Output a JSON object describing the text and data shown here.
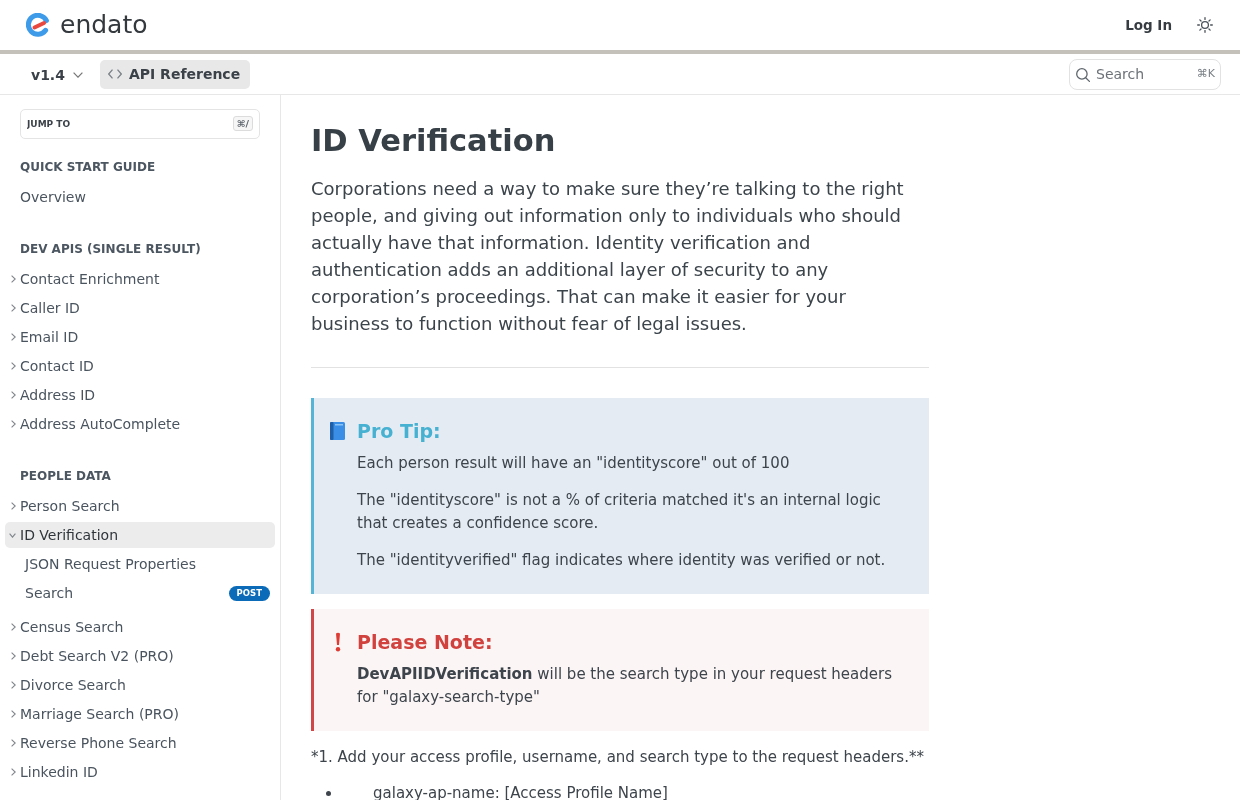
{
  "header": {
    "brand": "endato",
    "login": "Log In"
  },
  "subheader": {
    "version": "v1.4",
    "tabs": [
      {
        "label": "API Reference",
        "selected": true
      }
    ],
    "search": {
      "placeholder": "Search",
      "shortcut": "⌘K"
    }
  },
  "sidebar": {
    "jump_to": {
      "placeholder": "JUMP TO",
      "shortcut": "⌘/"
    },
    "sections": [
      {
        "heading": "QUICK START GUIDE",
        "items": [
          {
            "label": "Overview",
            "selected": false
          }
        ]
      },
      {
        "heading": "DEV APIS (SINGLE RESULT)",
        "items": [
          {
            "label": "Contact Enrichment",
            "selected": false,
            "expanded": false
          },
          {
            "label": "Caller ID",
            "selected": false,
            "expanded": false
          },
          {
            "label": "Email ID",
            "selected": false,
            "expanded": false
          },
          {
            "label": "Contact ID",
            "selected": false,
            "expanded": false
          },
          {
            "label": "Address ID",
            "selected": false,
            "expanded": false
          },
          {
            "label": "Address AutoComplete",
            "selected": false,
            "expanded": false
          }
        ]
      },
      {
        "heading": "PEOPLE DATA",
        "items": [
          {
            "label": "Person Search",
            "selected": false,
            "expanded": false
          },
          {
            "label": "ID Verification",
            "selected": true,
            "expanded": true,
            "children": [
              {
                "label": "JSON Request Properties",
                "selected": false
              },
              {
                "label": "Search",
                "selected": false,
                "badge": "POST"
              }
            ]
          },
          {
            "label": "Census Search",
            "selected": false,
            "expanded": false
          },
          {
            "label": "Debt Search V2 (PRO)",
            "selected": false,
            "expanded": false
          },
          {
            "label": "Divorce Search",
            "selected": false,
            "expanded": false
          },
          {
            "label": "Marriage Search (PRO)",
            "selected": false,
            "expanded": false
          },
          {
            "label": "Reverse Phone Search",
            "selected": false,
            "expanded": false
          },
          {
            "label": "Linkedin ID",
            "selected": false,
            "expanded": false
          }
        ]
      }
    ]
  },
  "main": {
    "title": "ID Verification",
    "intro": "Corporations need a way to make sure they’re talking to the right people, and giving out information only to individuals who should actually have that information. Identity verification and authentication adds an additional layer of security to any corporation’s proceedings. That can make it easier for your business to function without fear of legal issues.",
    "callouts": [
      {
        "kind": "tip",
        "heading": "Pro Tip:",
        "paragraphs": [
          "Each person result will have an \"identityscore\" out of 100",
          "The \"identityscore\" is not a % of criteria matched it's an internal logic that creates a confidence score.",
          "The \"identityverified\" flag indicates where identity was verified or not."
        ]
      },
      {
        "kind": "warning",
        "heading": "Please Note:",
        "paragraphs": [
          "**DevAPIIDVerification** will be the search type in your request headers for \"galaxy-search-type\""
        ]
      }
    ],
    "step": "*1. Add your access profile, username, and search type to the request headers.**",
    "bullets": [
      "galaxy-ap-name: [Access Profile Name]"
    ]
  }
}
